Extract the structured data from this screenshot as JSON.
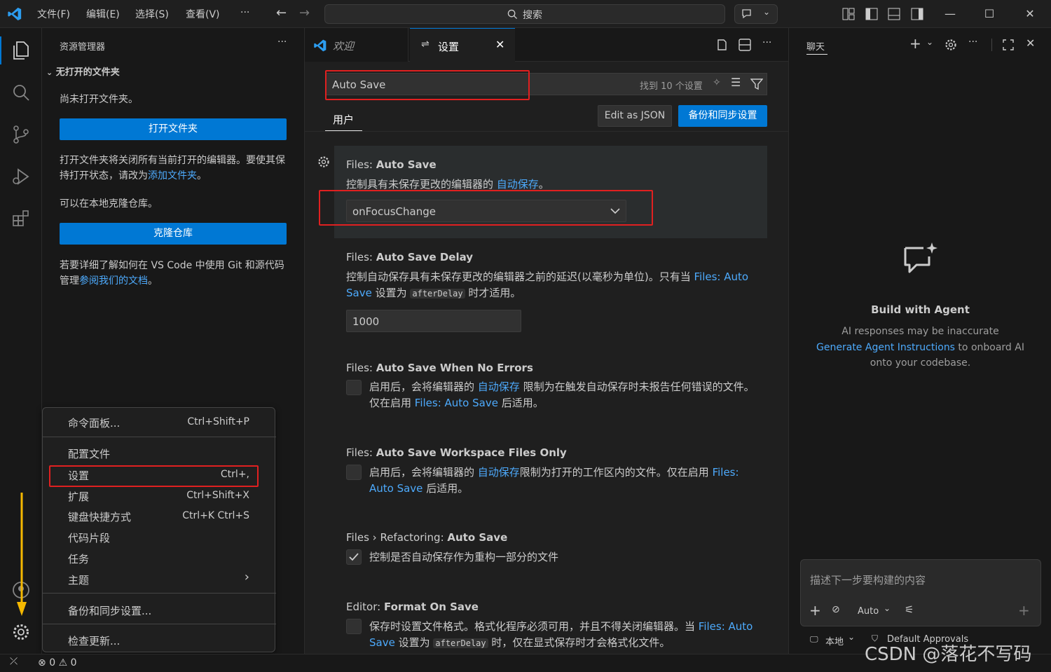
{
  "titlebar": {
    "menus": [
      "文件(F)",
      "编辑(E)",
      "选择(S)",
      "查看(V)",
      "···"
    ],
    "search_placeholder": "搜索"
  },
  "sidebar": {
    "title": "资源管理器",
    "section": "无打开的文件夹",
    "no_folder": "尚未打开文件夹。",
    "open_folder_btn": "打开文件夹",
    "para1": "打开文件夹将关闭所有当前打开的编辑器。要使其保持打开状态，请改为",
    "para1_link": "添加文件夹",
    "para1_end": "。",
    "clone_hint": "可以在本地克隆仓库。",
    "clone_btn": "克隆仓库",
    "para2": "若要详细了解如何在 VS Code 中使用 Git 和源代码管理",
    "para2_link": "参阅我们的文档",
    "para2_end": "。"
  },
  "editor": {
    "tabs": [
      {
        "label": "欢迎"
      },
      {
        "label": "设置"
      }
    ],
    "search_value": "Auto Save",
    "found_count": "找到 10 个设置",
    "scope_tab": "用户",
    "edit_json": "Edit as JSON",
    "backup_btn": "备份和同步设置",
    "settings": [
      {
        "category": "Files: ",
        "name": "Auto Save",
        "desc": "控制具有未保存更改的编辑器的 ",
        "desc_link": "自动保存",
        "desc_end": "。",
        "value": "onFocusChange"
      },
      {
        "category": "Files: ",
        "name": "Auto Save Delay",
        "desc": "控制自动保存具有未保存更改的编辑器之前的延迟(以毫秒为单位)。只有当 ",
        "desc_link": "Files: Auto Save",
        "desc_mid": " 设置为 ",
        "desc_code": "afterDelay",
        "desc_end": " 时才适用。",
        "value": "1000"
      },
      {
        "category": "Files: ",
        "name": "Auto Save When No Errors",
        "desc": "启用后，会将编辑器的 ",
        "desc_link": "自动保存",
        "desc_mid": " 限制为在触发自动保存时未报告任何错误的文件。仅在启用 ",
        "desc_link2": "Files: Auto Save",
        "desc_end": " 后适用。"
      },
      {
        "category": "Files: ",
        "name": "Auto Save Workspace Files Only",
        "desc": "启用后，会将编辑器的 ",
        "desc_link": "自动保存",
        "desc_mid": "限制为打开的工作区内的文件。仅在启用 ",
        "desc_link2": "Files: Auto Save",
        "desc_end": " 后适用。"
      },
      {
        "category": "Files › Refactoring: ",
        "name": "Auto Save",
        "desc": "控制是否自动保存作为重构一部分的文件",
        "checked": true
      },
      {
        "category": "Editor: ",
        "name": "Format On Save",
        "desc": "保存时设置文件格式。格式化程序必须可用，并且不得关闭编辑器。当 ",
        "desc_link": "Files: Auto Save",
        "desc_mid": " 设置为 ",
        "desc_code": "afterDelay",
        "desc_end": " 时，仅在显式保存时才会格式化文件。"
      }
    ]
  },
  "chat": {
    "title": "聊天",
    "heading": "Build with Agent",
    "line1": "AI responses may be inaccurate",
    "link": "Generate Agent Instructions",
    "line2": " to onboard AI",
    "line3": "onto your codebase.",
    "input_placeholder": "描述下一步要构建的内容",
    "mode": "Auto",
    "local": "本地",
    "approvals": "Default Approvals"
  },
  "context_menu": {
    "items": [
      {
        "label": "命令面板...",
        "key": "Ctrl+Shift+P"
      },
      {
        "label": "配置文件",
        "key": ""
      },
      {
        "label": "设置",
        "key": "Ctrl+,"
      },
      {
        "label": "扩展",
        "key": "Ctrl+Shift+X"
      },
      {
        "label": "键盘快捷方式",
        "key": "Ctrl+K Ctrl+S"
      },
      {
        "label": "代码片段",
        "key": ""
      },
      {
        "label": "任务",
        "key": ""
      },
      {
        "label": "主题",
        "key": "›"
      },
      {
        "label": "备份和同步设置...",
        "key": ""
      },
      {
        "label": "检查更新...",
        "key": ""
      }
    ]
  },
  "statusbar": {
    "errors": "0",
    "warnings": "0"
  },
  "watermark": "CSDN @落花不写码",
  "colors": {
    "accent": "#0078d4",
    "link": "#4daafc",
    "highlight": "#e02020",
    "arrow": "#f5b800"
  }
}
